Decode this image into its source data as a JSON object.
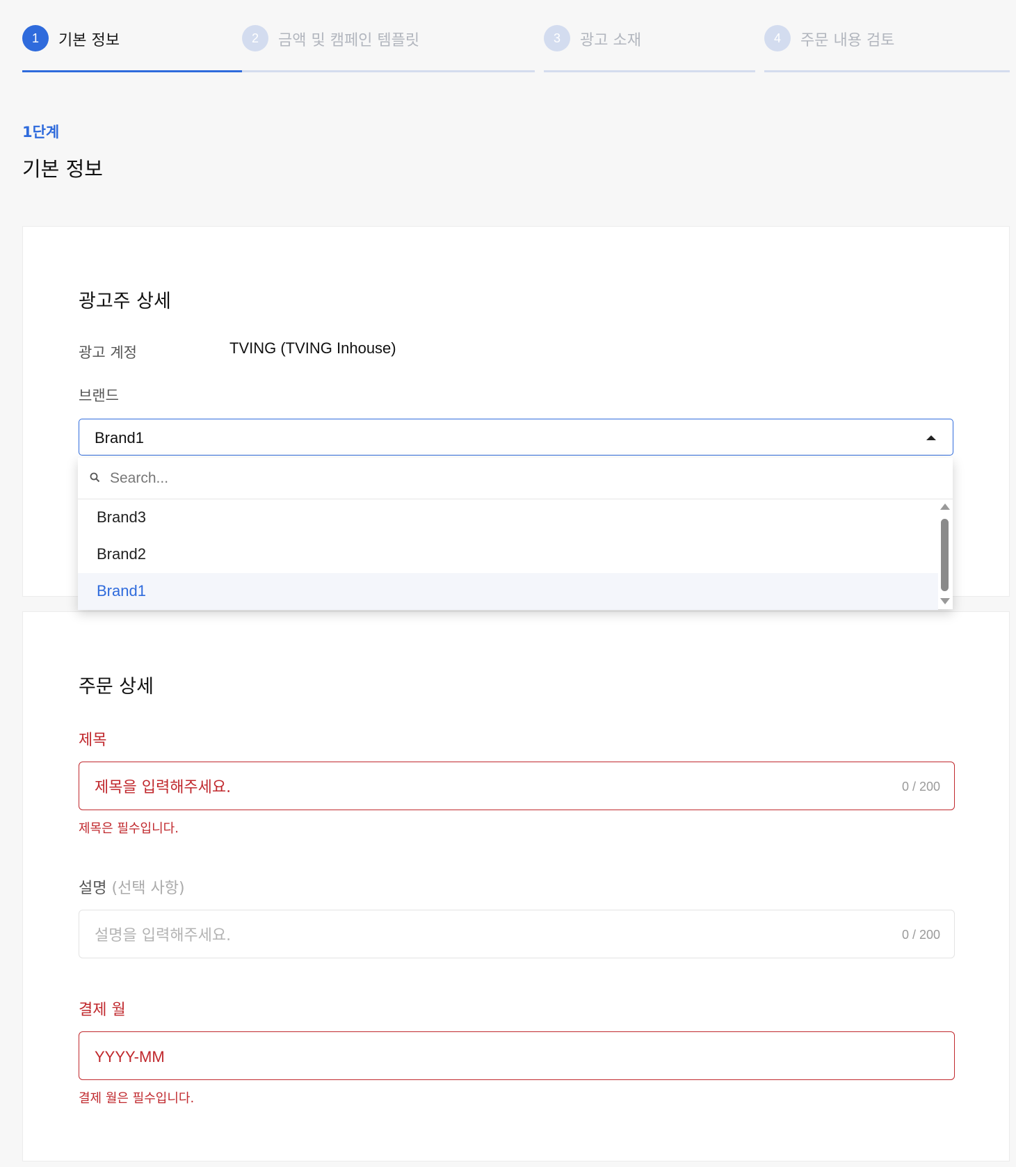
{
  "stepper": {
    "steps": [
      {
        "number": "1",
        "label": "기본 정보",
        "state": "active"
      },
      {
        "number": "2",
        "label": "금액 및 캠페인 템플릿",
        "state": "inactive"
      },
      {
        "number": "3",
        "label": "광고 소재",
        "state": "inactive"
      },
      {
        "number": "4",
        "label": "주문 내용 검토",
        "state": "inactive"
      }
    ]
  },
  "page": {
    "kicker": "1단계",
    "title": "기본 정보"
  },
  "advertiser_section": {
    "title": "광고주 상세",
    "account_label": "광고 계정",
    "account_value": "TVING (TVING Inhouse)",
    "brand_label": "브랜드",
    "brand_selected": "Brand1",
    "dropdown": {
      "search_placeholder": "Search...",
      "options": [
        "Brand3",
        "Brand2",
        "Brand1"
      ],
      "selected_index": 2
    }
  },
  "order_section": {
    "title": "주문 상세",
    "title_field": {
      "label": "제목",
      "placeholder": "제목을 입력해주세요.",
      "counter": "0 / 200",
      "error": "제목은 필수입니다."
    },
    "description_field": {
      "label": "설명",
      "optional_label": "(선택 사항)",
      "placeholder": "설명을 입력해주세요.",
      "counter": "0 / 200"
    },
    "billing_month_field": {
      "label": "결제 월",
      "placeholder": "YYYY-MM",
      "error": "결제 월은 필수입니다."
    }
  },
  "colors": {
    "accent": "#2f6bdc",
    "error": "#c0282d",
    "inactive_step": "#d3dcef",
    "background": "#f7f7f7"
  },
  "icons": {
    "search": "search-icon",
    "caret": "caret-up-icon"
  }
}
